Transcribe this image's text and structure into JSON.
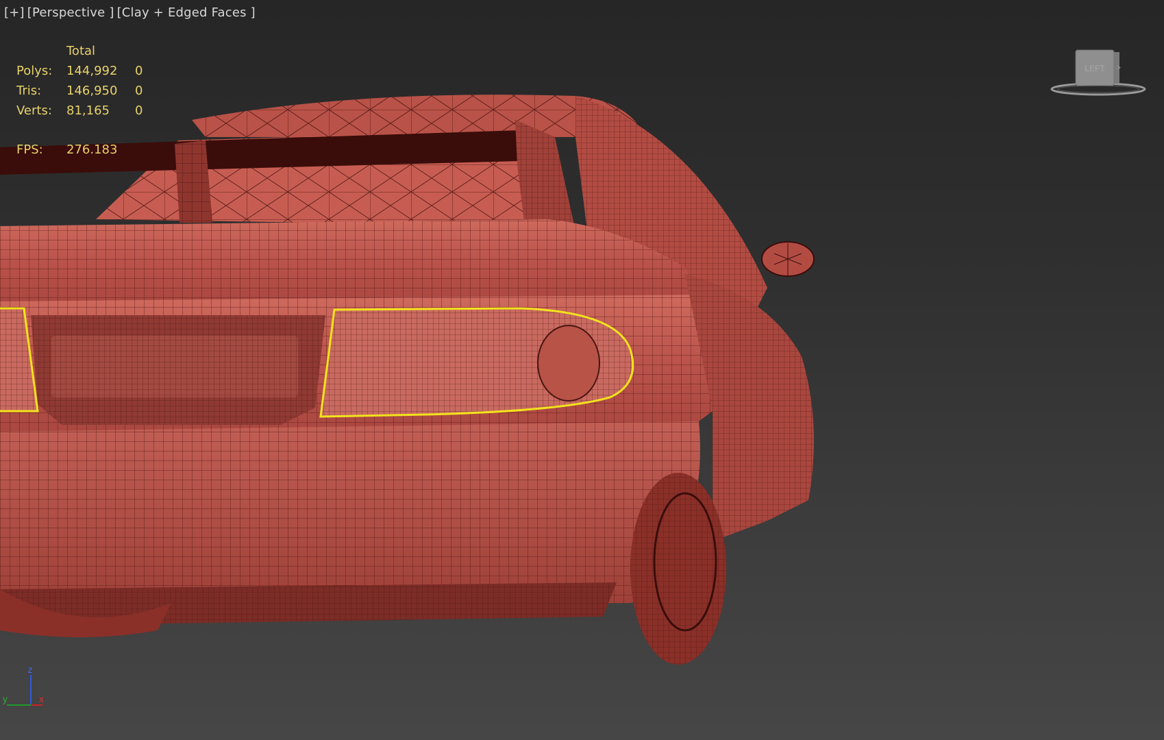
{
  "viewport": {
    "label_plus": "[+]",
    "label_view": "[Perspective ]",
    "label_shading": "[Clay + Edged Faces ]"
  },
  "stats": {
    "header": "Total",
    "rows": [
      {
        "label": "Polys:",
        "total": "144,992",
        "selected": "0"
      },
      {
        "label": "Tris:",
        "total": "146,950",
        "selected": "0"
      },
      {
        "label": "Verts:",
        "total": "81,165",
        "selected": "0"
      }
    ],
    "fps_label": "FPS:",
    "fps_value": "276.183"
  },
  "viewcube": {
    "face_label": "LEFT"
  },
  "axis_tripod": {
    "z": "z",
    "y": "y",
    "x": "x"
  },
  "colors": {
    "model_fill": "#c0554b",
    "wire": "#4a1410",
    "selection": "#f2e21d",
    "stats_text": "#e8d26b"
  }
}
